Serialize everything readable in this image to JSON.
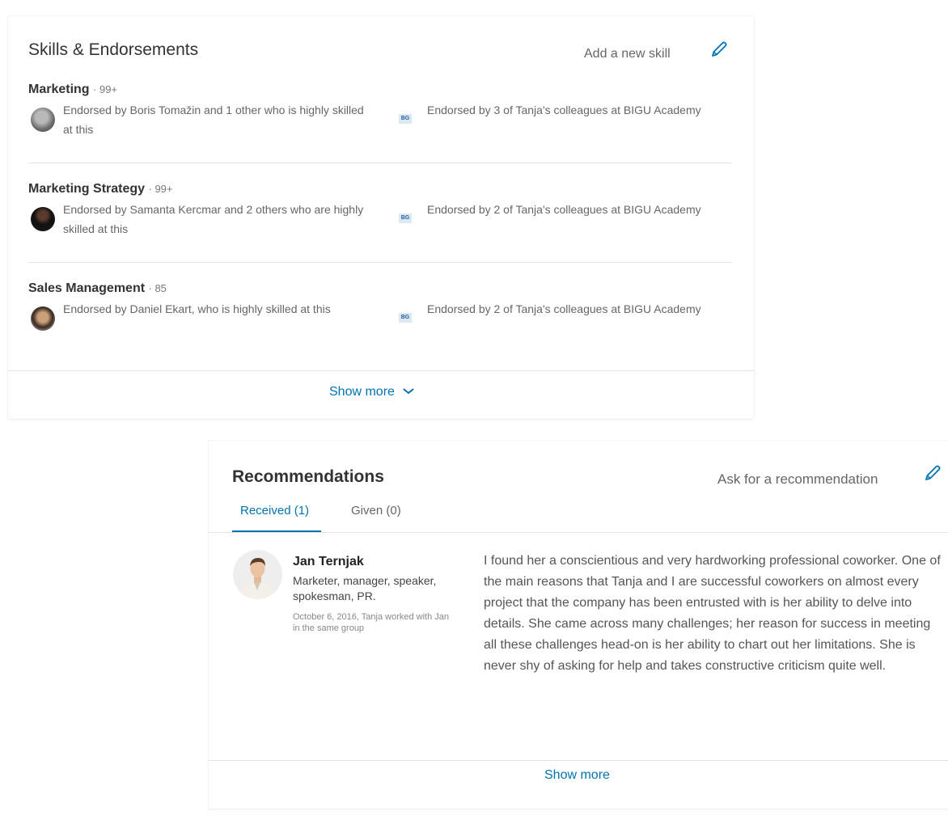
{
  "skills": {
    "title": "Skills & Endorsements",
    "add_label": "Add a new skill",
    "edit_icon": "pencil-icon",
    "items": [
      {
        "name": "Marketing",
        "count": "· 99+",
        "left_text": "Endorsed by Boris Tomažin and 1 other who is highly skilled at this",
        "right_text": "Endorsed by 3 of Tanja's colleagues at BIGU Academy",
        "logo": "BG"
      },
      {
        "name": "Marketing Strategy",
        "count": "· 99+",
        "left_text": "Endorsed by Samanta Kercmar and 2 others who are highly skilled at this",
        "right_text": "Endorsed by 2 of Tanja's colleagues at BIGU Academy",
        "logo": "BG"
      },
      {
        "name": "Sales Management",
        "count": "· 85",
        "left_text": "Endorsed by Daniel Ekart, who is highly skilled at this",
        "right_text": "Endorsed by 2 of Tanja's colleagues at BIGU Academy",
        "logo": "BG"
      }
    ],
    "show_more": "Show more",
    "show_more_icon": "chevron-down-icon"
  },
  "recommendations": {
    "title": "Recommendations",
    "ask_label": "Ask for a recommendation",
    "edit_icon": "pencil-icon",
    "tabs": [
      {
        "label": "Received (1)",
        "active": true
      },
      {
        "label": "Given (0)",
        "active": false
      }
    ],
    "item": {
      "name": "Jan Ternjak",
      "role": "Marketer, manager, speaker, spokesman, PR.",
      "date": "October 6, 2016, Tanja worked with Jan in the same group",
      "text": "I found her a conscientious and very hardworking professional coworker. One of the main reasons that Tanja and I are successful coworkers on almost every project that the company has been entrusted with is her ability to delve into details. She came across many challenges; her reason for success in meeting all these challenges head-on is her ability to chart out her limitations. She is never shy of asking for help and takes constructive criticism quite well."
    },
    "show_more": "Show more"
  },
  "colors": {
    "link": "#0073b1",
    "text_primary": "#333333",
    "text_secondary": "#666666",
    "divider": "#e3e3e3"
  }
}
